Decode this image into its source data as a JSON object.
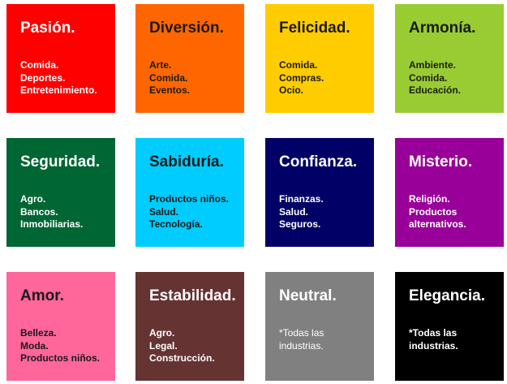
{
  "tiles": [
    {
      "title": "Pasión.",
      "items": [
        "Comida.",
        "Deportes.",
        "Entretenimiento."
      ],
      "bg": "#ff0000",
      "fg": "#ffffff"
    },
    {
      "title": "Diversión.",
      "items": [
        "Arte.",
        "Comida.",
        "Eventos."
      ],
      "bg": "#ff6600",
      "fg": "#1a1a1a"
    },
    {
      "title": "Felicidad.",
      "items": [
        "Comida.",
        "Compras.",
        "Ocio."
      ],
      "bg": "#ffcc00",
      "fg": "#1a1a1a"
    },
    {
      "title": "Armonía.",
      "items": [
        "Ambiente.",
        "Comida.",
        "Educación."
      ],
      "bg": "#99cc33",
      "fg": "#1a1a1a"
    },
    {
      "title": "Seguridad.",
      "items": [
        "Agro.",
        "Bancos.",
        "Inmobiliarias."
      ],
      "bg": "#006633",
      "fg": "#ffffff"
    },
    {
      "title": "Sabiduría.",
      "items": [
        "Productos niños.",
        "Salud.",
        "Tecnología."
      ],
      "bg": "#00ccff",
      "fg": "#1a1a1a"
    },
    {
      "title": "Confianza.",
      "items": [
        "Finanzas.",
        "Salud.",
        "Seguros."
      ],
      "bg": "#000066",
      "fg": "#ffffff"
    },
    {
      "title": "Misterio.",
      "items": [
        "Religión.",
        "Productos alternativos."
      ],
      "bg": "#990099",
      "fg": "#ffffff"
    },
    {
      "title": "Amor.",
      "items": [
        "Belleza.",
        "Moda.",
        "Productos niños."
      ],
      "bg": "#ff6699",
      "fg": "#1a1a1a"
    },
    {
      "title": "Estabilidad.",
      "items": [
        "Agro.",
        "Legal.",
        "Construcción."
      ],
      "bg": "#663333",
      "fg": "#ffffff"
    },
    {
      "title": "Neutral.",
      "items": [
        "*Todas las industrias."
      ],
      "bg": "#808080",
      "fg": "#ffffff"
    },
    {
      "title": "Elegancia.",
      "items": [
        "*Todas las industrias."
      ],
      "bg": "#000000",
      "fg": "#ffffff"
    }
  ]
}
